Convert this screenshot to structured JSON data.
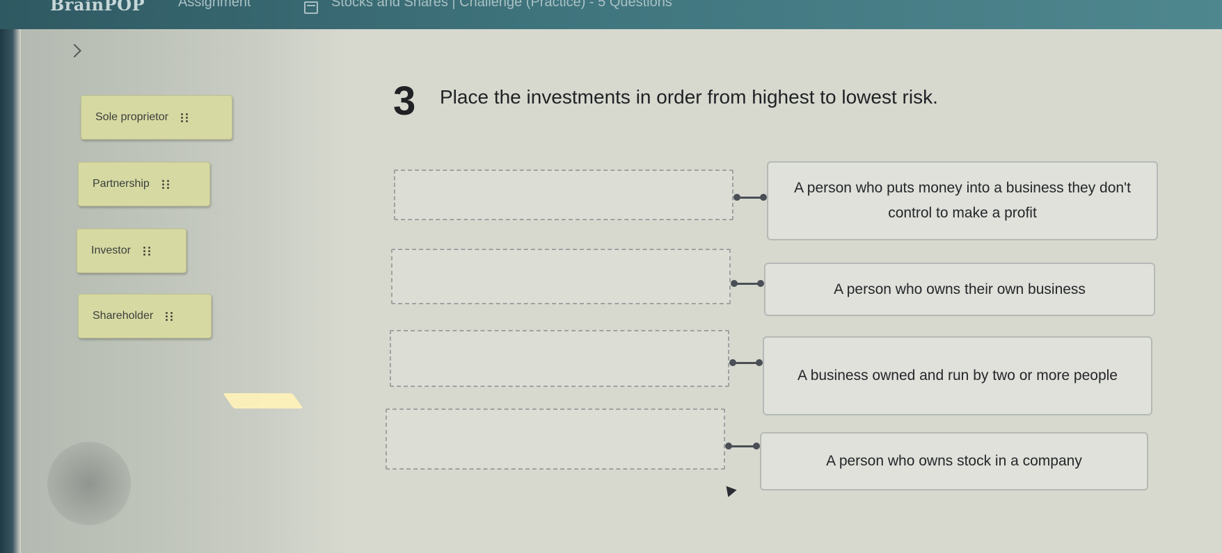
{
  "topbar": {
    "brand": "BrainPOP",
    "assignment_label": "Assignment",
    "breadcrumb": "Stocks and Shares | Challenge (Practice) - 5 Questions"
  },
  "question": {
    "number": "3",
    "prompt": "Place the investments in order from highest to lowest risk."
  },
  "options": [
    {
      "label": "Sole proprietor"
    },
    {
      "label": "Partnership"
    },
    {
      "label": "Investor"
    },
    {
      "label": "Shareholder"
    }
  ],
  "definitions": [
    {
      "text": "A person who puts money into a business they don't control to make a profit"
    },
    {
      "text": "A person who owns their own business"
    },
    {
      "text": "A business owned and run by two or more people"
    },
    {
      "text": "A person who owns stock in a company"
    }
  ],
  "colors": {
    "chip_bg": "#d6d9a2",
    "topbar": "#3f747d",
    "card_bg": "#dfe1da"
  }
}
